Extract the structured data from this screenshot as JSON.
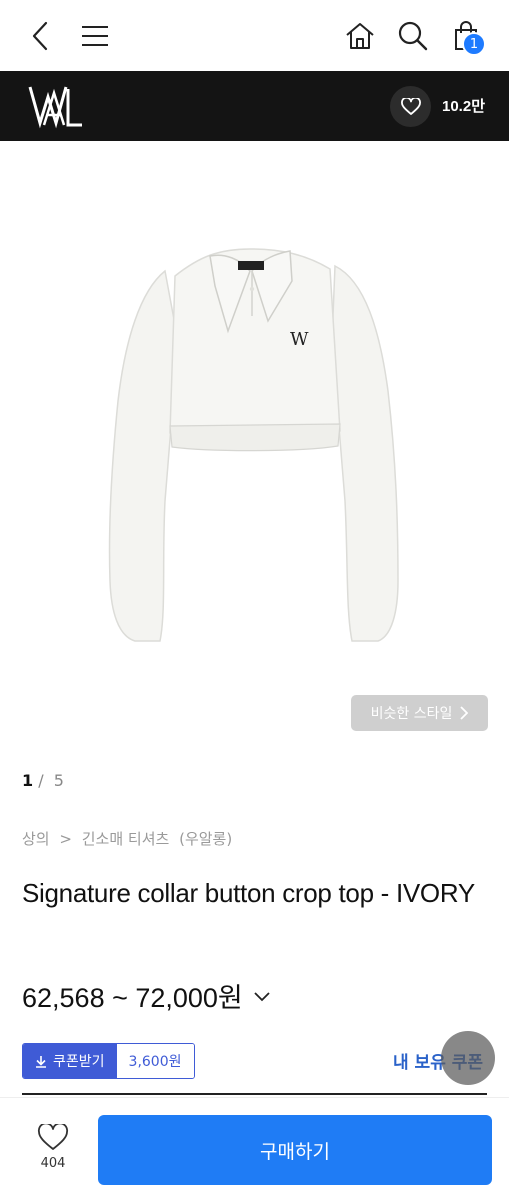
{
  "header": {
    "back_icon": "chevron-left-icon",
    "menu_icon": "hamburger-menu-icon",
    "home_icon": "home-icon",
    "search_icon": "search-icon",
    "cart_icon": "shopping-bag-icon",
    "cart_count": "1"
  },
  "brand_bar": {
    "logo": "WAL",
    "like_icon": "heart-icon",
    "like_count": "10.2만"
  },
  "gallery": {
    "similar_style_label": "비슷한 스타일",
    "current_page": "1",
    "separator": "/",
    "total_pages": "5"
  },
  "product": {
    "breadcrumb": [
      "상의",
      ">",
      "긴소매 티셔츠",
      "(우알롱)"
    ],
    "title": "Signature collar button crop top - IVORY",
    "price": "62,568 ~ 72,000원",
    "coupon_label": "쿠폰받기",
    "coupon_amount": "3,600원",
    "my_coupon_label": "내 보유 쿠폰"
  },
  "bottom_bar": {
    "wish_count": "404",
    "buy_label": "구매하기"
  },
  "colors": {
    "accent": "#1f7cf5",
    "coupon_blue": "#3f5bd6",
    "brand_bar": "#141414"
  }
}
